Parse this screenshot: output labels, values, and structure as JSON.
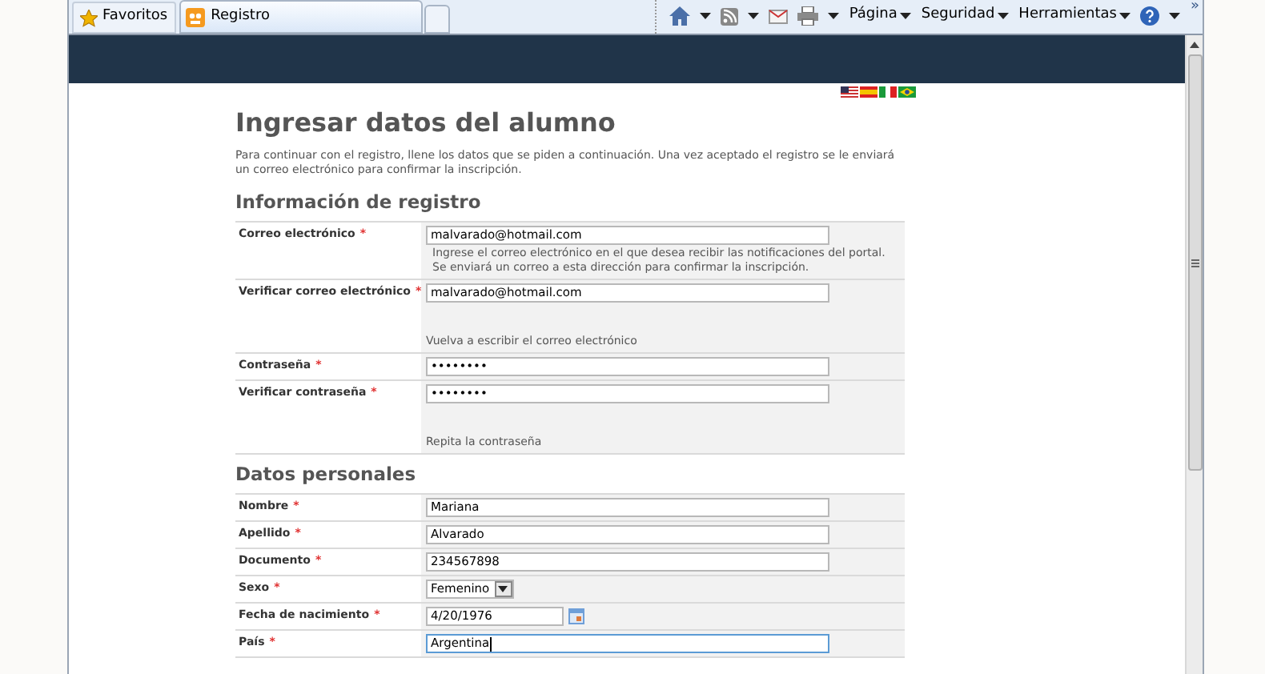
{
  "browser": {
    "favorites": "Favoritos",
    "tabs": [
      {
        "label": "Registro",
        "selected": true,
        "kind": "page"
      },
      {
        "kind": "new",
        "selected": false
      }
    ],
    "menus": [
      {
        "label": "Página"
      },
      {
        "label": "Seguridad"
      },
      {
        "label": "Herramientas"
      }
    ],
    "overflow": "»"
  },
  "page": {
    "title": "Ingresar datos del alumno",
    "intro": "Para continuar con el registro, llene los datos que se piden a continuación. Una vez aceptado el registro se le enviará un correo electrónico para confirmar la inscripción.",
    "sections": [
      {
        "heading": "Información de registro",
        "fields": [
          {
            "label": "Correo electrónico",
            "mark": "*",
            "kind": "text",
            "value": "malvarado@hotmail.com",
            "hint": "Ingrese el correo electrónico en el que desea recibir las notificaciones del portal. Se enviará un correo a esta dirección para confirmar la inscripción.",
            "hint_gap": false,
            "focused": false
          },
          {
            "label": "Verificar correo electrónico",
            "mark": "*",
            "kind": "text",
            "value": "malvarado@hotmail.com",
            "hint": "Vuelva a escribir el correo electrónico",
            "hint_gap": true,
            "focused": false
          },
          {
            "label": "Contraseña",
            "mark": "*",
            "kind": "text",
            "value": "••••••••",
            "focused": false
          },
          {
            "label": "Verificar contraseña",
            "mark": "*",
            "kind": "text",
            "value": "••••••••",
            "hint": "Repita la contraseña",
            "hint_gap": true,
            "focused": false
          }
        ]
      },
      {
        "heading": "Datos personales",
        "fields": [
          {
            "label": "Nombre",
            "mark": "*",
            "kind": "text",
            "value": "Mariana",
            "focused": false
          },
          {
            "label": "Apellido",
            "mark": "*",
            "kind": "text",
            "value": "Alvarado",
            "focused": false
          },
          {
            "label": "Documento",
            "mark": "*",
            "kind": "text",
            "value": "234567898",
            "focused": false
          },
          {
            "label": "Sexo",
            "mark": "*",
            "kind": "select",
            "value": "Femenino",
            "focused": false
          },
          {
            "label": "Fecha de nacimiento",
            "mark": "*",
            "kind": "date",
            "value": "4/20/1976",
            "focused": false
          },
          {
            "label": "País",
            "mark": "*",
            "kind": "text",
            "value": "Argentina",
            "focused": true
          }
        ]
      }
    ]
  }
}
